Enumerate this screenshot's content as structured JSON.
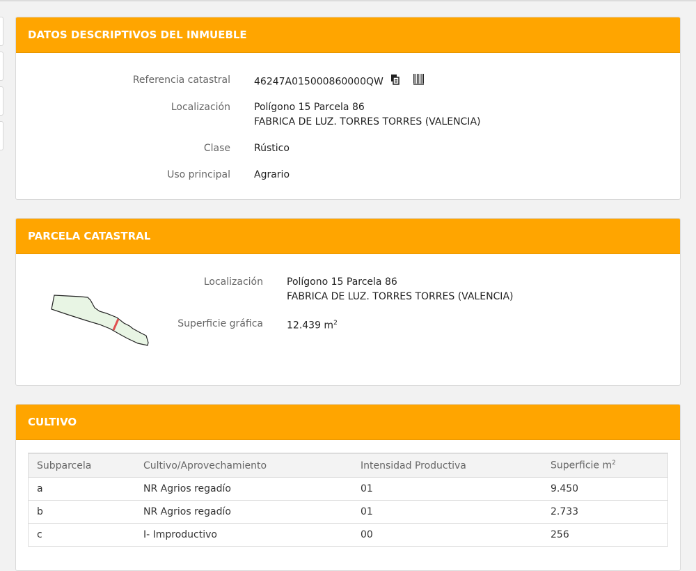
{
  "descriptive": {
    "title": "DATOS DESCRIPTIVOS DEL INMUEBLE",
    "ref_label": "Referencia catastral",
    "ref_value": "46247A015000860000QW",
    "loc_label": "Localización",
    "loc_line1": "Polígono 15 Parcela 86",
    "loc_line2": "FABRICA DE LUZ. TORRES TORRES (VALENCIA)",
    "class_label": "Clase",
    "class_value": "Rústico",
    "use_label": "Uso principal",
    "use_value": "Agrario",
    "icons": [
      "copy-icon",
      "barcode-icon"
    ]
  },
  "parcel": {
    "title": "PARCELA CATASTRAL",
    "loc_label": "Localización",
    "loc_line1": "Polígono 15 Parcela 86",
    "loc_line2": "FABRICA DE LUZ. TORRES TORRES (VALENCIA)",
    "area_label": "Superficie gráfica",
    "area_value": "12.439 m",
    "area_unit_sup": "2"
  },
  "crops": {
    "title": "CULTIVO",
    "headers": {
      "subparcel": "Subparcela",
      "crop": "Cultivo/Aprovechamiento",
      "intensity": "Intensidad Productiva",
      "area": "Superficie m",
      "area_sup": "2"
    },
    "rows": [
      {
        "subparcel": "a",
        "crop": "NR Agrios regadío",
        "intensity": "01",
        "area": "9.450"
      },
      {
        "subparcel": "b",
        "crop": "NR Agrios regadío",
        "intensity": "01",
        "area": "2.733"
      },
      {
        "subparcel": "c",
        "crop": "I- Improductivo",
        "intensity": "00",
        "area": "256"
      }
    ]
  },
  "colors": {
    "header": "#ffa500",
    "parcel_fill": "#e8f5e4",
    "parcel_divider": "#e05050"
  }
}
